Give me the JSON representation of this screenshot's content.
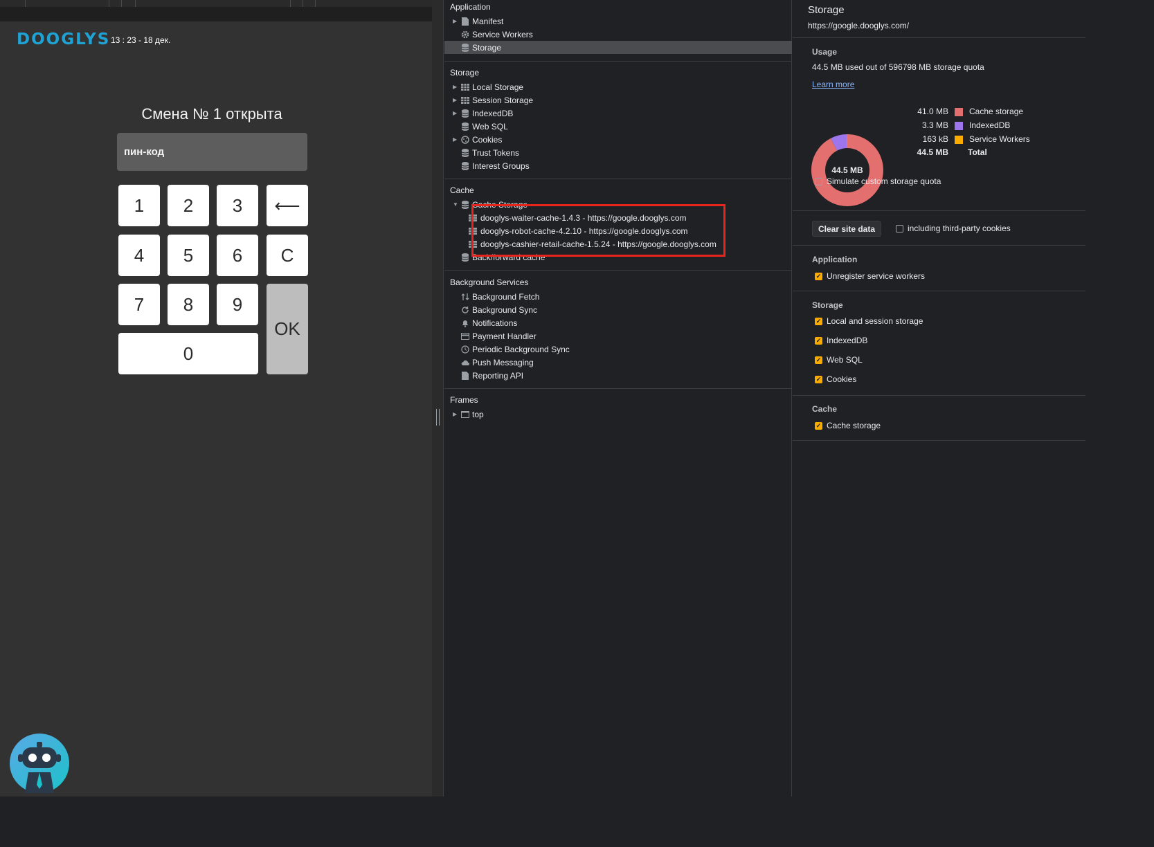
{
  "app": {
    "logo": "DOOGLYS",
    "datetime": "13 : 23 - 18 дек.",
    "shift_title": "Смена № 1 открыта",
    "pin_placeholder": "пин-код",
    "keys": {
      "k1": "1",
      "k2": "2",
      "k3": "3",
      "backspace": "⟵",
      "k4": "4",
      "k5": "5",
      "k6": "6",
      "clear": "C",
      "k7": "7",
      "k8": "8",
      "k9": "9",
      "ok": "OK",
      "k0": "0"
    }
  },
  "tree": {
    "application": {
      "title": "Application",
      "items": [
        {
          "label": "Manifest",
          "icon": "file-icon"
        },
        {
          "label": "Service Workers",
          "icon": "gear-icon"
        },
        {
          "label": "Storage",
          "icon": "database-icon",
          "selected": true
        }
      ]
    },
    "storage": {
      "title": "Storage",
      "items": [
        {
          "label": "Local Storage",
          "icon": "grid-icon"
        },
        {
          "label": "Session Storage",
          "icon": "grid-icon"
        },
        {
          "label": "IndexedDB",
          "icon": "database-icon"
        },
        {
          "label": "Web SQL",
          "icon": "database-icon"
        },
        {
          "label": "Cookies",
          "icon": "cookie-icon"
        },
        {
          "label": "Trust Tokens",
          "icon": "database-icon"
        },
        {
          "label": "Interest Groups",
          "icon": "database-icon"
        }
      ]
    },
    "cache": {
      "title": "Cache",
      "cache_storage_label": "Cache Storage",
      "entries": [
        "dooglys-waiter-cache-1.4.3 - https://google.dooglys.com",
        "dooglys-robot-cache-4.2.10 - https://google.dooglys.com",
        "dooglys-cashier-retail-cache-1.5.24 - https://google.dooglys.com"
      ],
      "bfcache_label": "Back/forward cache"
    },
    "background_services": {
      "title": "Background Services",
      "items": [
        {
          "label": "Background Fetch",
          "icon": "fetch-arrows-icon"
        },
        {
          "label": "Background Sync",
          "icon": "sync-icon"
        },
        {
          "label": "Notifications",
          "icon": "bell-icon"
        },
        {
          "label": "Payment Handler",
          "icon": "card-icon"
        },
        {
          "label": "Periodic Background Sync",
          "icon": "clock-icon"
        },
        {
          "label": "Push Messaging",
          "icon": "cloud-icon"
        },
        {
          "label": "Reporting API",
          "icon": "file-icon"
        }
      ]
    },
    "frames": {
      "title": "Frames",
      "items": [
        {
          "label": "top",
          "icon": "frame-icon"
        }
      ]
    }
  },
  "pane": {
    "title": "Storage",
    "url": "https://google.dooglys.com/",
    "usage": {
      "heading": "Usage",
      "summary": "44.5 MB used out of 596798 MB storage quota",
      "learn_more": "Learn more",
      "donut_center": "44.5 MB",
      "simulate_label": "Simulate custom storage quota",
      "simulate_checked": false
    },
    "clear_button": "Clear site data",
    "third_party_label": "including third-party cookies",
    "third_party_checked": false,
    "application": {
      "heading": "Application",
      "options": [
        {
          "label": "Unregister service workers",
          "checked": true
        }
      ]
    },
    "storage": {
      "heading": "Storage",
      "options": [
        {
          "label": "Local and session storage",
          "checked": true
        },
        {
          "label": "IndexedDB",
          "checked": true
        },
        {
          "label": "Web SQL",
          "checked": true
        },
        {
          "label": "Cookies",
          "checked": true
        }
      ]
    },
    "cache": {
      "heading": "Cache",
      "options": [
        {
          "label": "Cache storage",
          "checked": true
        }
      ]
    }
  },
  "chart_data": {
    "type": "pie",
    "categories": [
      "Cache storage",
      "IndexedDB",
      "Service Workers"
    ],
    "display_values": [
      "41.0 MB",
      "3.3 MB",
      "163 kB"
    ],
    "values_mb": [
      41.0,
      3.3,
      0.163
    ],
    "colors": [
      "#e46f6f",
      "#9d76ee",
      "#f9ab00"
    ],
    "total_label": "Total",
    "total_value": "44.5 MB"
  },
  "colors": {
    "accent_checkbox": "#f9ab00",
    "highlight_box": "#e8251c",
    "logo": "#1fa2d4",
    "link": "#8ab4f8"
  }
}
